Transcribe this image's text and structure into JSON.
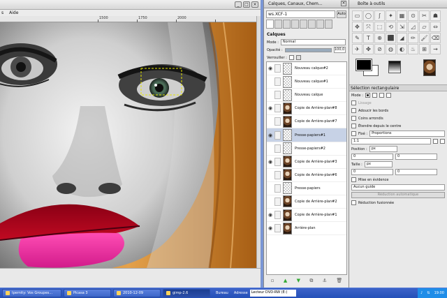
{
  "image_window": {
    "menu": [
      "s",
      "Aide"
    ],
    "ruler": [
      "1500",
      "1750",
      "2000"
    ]
  },
  "layers_dock": {
    "title": "Calques, Canaux, Chem...",
    "image_selector": "ws.XCF-1",
    "auto_label": "Auto",
    "section_title": "Calques",
    "mode_label": "Mode :",
    "mode_value": "Normal",
    "opacity_label": "Opacité :",
    "opacity_value": "100,0",
    "opacity_fraction": 1.0,
    "lock_label": "Verrouiller :",
    "layers": [
      {
        "name": "Nouveau calque#2",
        "visible": true,
        "thumb": "checker"
      },
      {
        "name": "Nouveau calque#1",
        "visible": false,
        "thumb": "checker"
      },
      {
        "name": "Nouveau calque",
        "visible": false,
        "thumb": "checker"
      },
      {
        "name": "Copie de Arrière-plan#8",
        "visible": true,
        "thumb": "portrait"
      },
      {
        "name": "Copie de Arrière-plan#7",
        "visible": false,
        "thumb": "portrait"
      },
      {
        "name": "Presse-papiers#1",
        "visible": true,
        "thumb": "checker",
        "selected": true
      },
      {
        "name": "Presse-papiers#2",
        "visible": false,
        "thumb": "checker"
      },
      {
        "name": "Copie de Arrière-plan#3",
        "visible": true,
        "thumb": "portrait"
      },
      {
        "name": "Copie de Arrière-plan#6",
        "visible": false,
        "thumb": "portrait"
      },
      {
        "name": "Presse-papiers",
        "visible": false,
        "thumb": "checker"
      },
      {
        "name": "Copie de Arrière-plan#2",
        "visible": false,
        "thumb": "portrait"
      },
      {
        "name": "Copie de Arrière-plan#1",
        "visible": true,
        "thumb": "portrait"
      },
      {
        "name": "Arrière-plan",
        "visible": true,
        "thumb": "portrait"
      }
    ],
    "bottom_buttons": [
      "new-layer-icon",
      "raise-icon",
      "lower-icon",
      "duplicate-icon",
      "anchor-icon",
      "delete-icon"
    ]
  },
  "toolbox": {
    "title": "Boîte à outils",
    "tools": [
      "▭",
      "◯",
      "ʃ",
      "✦",
      "▦",
      "⊙",
      "✂",
      "☗",
      "✥",
      "⤧",
      "⬚",
      "⟲",
      "⇲",
      "◿",
      "▱",
      "⇔",
      "✎",
      "T",
      "⊕",
      "⬛",
      "◢",
      "✏",
      "🖌",
      "⌫",
      "✈",
      "✤",
      "⊘",
      "◍",
      "◐",
      "♨",
      "⊞",
      "⇝"
    ],
    "options_title": "Sélection rectangulaire",
    "mode_label": "Mode :",
    "lissage_label": "Lissage",
    "adoucir_label": "Adoucir les bords",
    "coins_label": "Coins arrondis",
    "etendre_label": "Étendre depuis le centre",
    "fixe_label": "Fixé :",
    "fixe_value": "Proportions",
    "ratio_value": "1:1",
    "position_label": "Position :",
    "position_unit": "px",
    "pos_x": "0",
    "pos_y": "0",
    "taille_label": "Taille :",
    "taille_unit": "px",
    "size_w": "0",
    "size_h": "0",
    "mise_label": "Mise en évidence",
    "guide_value": "Aucun guide",
    "reduction_btn": "Réduction automatique",
    "fusion_label": "Réduction fusionnée"
  },
  "taskbar": {
    "tasks": [
      {
        "label": "Ipernity: Vos Groupes...",
        "active": false
      },
      {
        "label": "Picasa 3",
        "active": false
      },
      {
        "label": "2010-12-09",
        "active": false
      },
      {
        "label": "gimp-2.6",
        "active": true
      }
    ],
    "bureau": "Bureau",
    "adresse": "Adresse",
    "address_value": "Lecteur DVD-RW (E:)",
    "clock": "19:00"
  }
}
